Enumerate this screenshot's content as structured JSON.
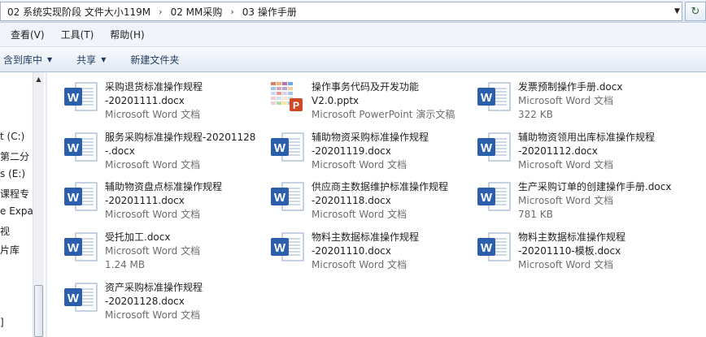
{
  "address": {
    "crumbs": [
      "02 系统实现阶段 文件大小119M",
      "02 MM采购",
      "03 操作手册"
    ],
    "separator": "›",
    "dropdown_glyph": "▼",
    "refresh_glyph": "↻"
  },
  "menu": [
    "查看(V)",
    "工具(T)",
    "帮助(H)"
  ],
  "toolbar": {
    "include_label": "含到库中",
    "share_label": "共享",
    "new_folder_label": "新建文件夹",
    "caret": "▼"
  },
  "nav": {
    "items": [
      "t (C:)",
      "第二分",
      "s (E:)",
      "课程专",
      "e Expar",
      "视",
      "片库",
      "]"
    ],
    "scroll_up_glyph": "▲"
  },
  "files": [
    {
      "line1": "采购退货标准操作规程",
      "line2": "-20201111.docx",
      "type": "Microsoft Word 文档",
      "size": "",
      "kind": "word"
    },
    {
      "line1": "操作事务代码及开发功能",
      "line2": "V2.0.pptx",
      "type": "Microsoft PowerPoint 演示文稿",
      "size": "",
      "kind": "ppt"
    },
    {
      "line1": "发票预制操作手册.docx",
      "line2": "",
      "type": "Microsoft Word 文档",
      "size": "322 KB",
      "kind": "word"
    },
    {
      "line1": "服务采购标准操作规程-20201128",
      "line2": "-.docx",
      "type": "Microsoft Word 文档",
      "size": "",
      "kind": "word"
    },
    {
      "line1": "辅助物资采购标准操作规程",
      "line2": "-20201119.docx",
      "type": "Microsoft Word 文档",
      "size": "",
      "kind": "word"
    },
    {
      "line1": "辅助物资领用出库标准操作规程",
      "line2": "-20201112.docx",
      "type": "Microsoft Word 文档",
      "size": "",
      "kind": "word"
    },
    {
      "line1": "辅助物资盘点标准操作规程",
      "line2": "-20201111.docx",
      "type": "Microsoft Word 文档",
      "size": "",
      "kind": "word"
    },
    {
      "line1": "供应商主数据维护标准操作规程",
      "line2": "-20201118.docx",
      "type": "Microsoft Word 文档",
      "size": "",
      "kind": "word"
    },
    {
      "line1": "生产采购订单的创建操作手册.docx",
      "line2": "",
      "type": "Microsoft Word 文档",
      "size": "781 KB",
      "kind": "word"
    },
    {
      "line1": "受托加工.docx",
      "line2": "",
      "type": "Microsoft Word 文档",
      "size": "1.24 MB",
      "kind": "word"
    },
    {
      "line1": "物料主数据标准操作规程",
      "line2": "-20201110.docx",
      "type": "Microsoft Word 文档",
      "size": "",
      "kind": "word"
    },
    {
      "line1": "物料主数据标准操作规程",
      "line2": "-20201110-模板.docx",
      "type": "Microsoft Word 文档",
      "size": "",
      "kind": "word"
    },
    {
      "line1": "资产采购标准操作规程",
      "line2": "-20201128.docx",
      "type": "Microsoft Word 文档",
      "size": "",
      "kind": "word"
    }
  ]
}
